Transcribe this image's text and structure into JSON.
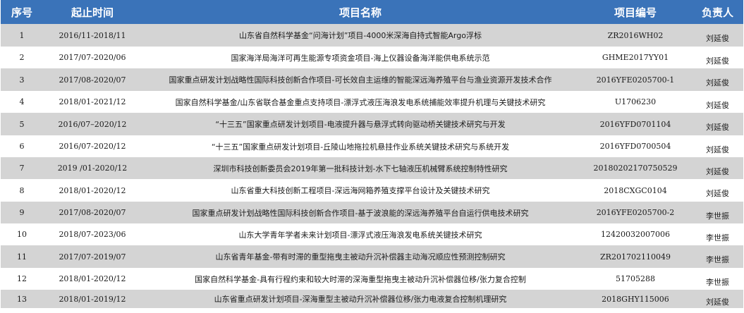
{
  "table": {
    "headers": {
      "index": "序号",
      "period": "起止时间",
      "name": "项目名称",
      "code": "项目编号",
      "owner": "负责人"
    },
    "rows": [
      {
        "index": "1",
        "period": "2016/11-2018/11",
        "name": "山东省自然科学基金“问海计划”项目-4000米深海自持式智能Argo浮标",
        "code": "ZR2016WH02",
        "owner": "刘延俊"
      },
      {
        "index": "2",
        "period": "2017/07-2020/06",
        "name": "国家海洋局海洋可再生能源专项资金项目-海上仪器设备海洋能供电系统示范",
        "code": "GHME2017YY01",
        "owner": "刘延俊"
      },
      {
        "index": "3",
        "period": "2017/08-2020/07",
        "name": "国家重点研发计划战略性国际科技创新合作项目-可长效自主运维的智能深远海养殖平台与渔业资源开发技术合作",
        "code": "2016YFE0205700-1",
        "owner": "刘延俊"
      },
      {
        "index": "4",
        "period": "2018/01-2021/12",
        "name": "国家自然科学基金/山东省联合基金重点支持项目-漂浮式液压海浪发电系统捕能效率提升机理与关键技术研究",
        "code": "U1706230",
        "owner": "刘延俊"
      },
      {
        "index": "5",
        "period": "2016/07–2020/12",
        "name": "“十三五”国家重点研发计划项目-电液提升器与悬浮式转向驱动桥关键技术研究与开发",
        "code": "2016YFD0701104",
        "owner": "刘延俊"
      },
      {
        "index": "6",
        "period": "2016/07-2020/12",
        "name": "“十三五”国家重点研发计划项目-丘陵山地拖拉机悬挂作业系统关键技术研究与系统开发",
        "code": "2016YFD0700504",
        "owner": "刘延俊"
      },
      {
        "index": "7",
        "period": "2019 /01-2020/12",
        "name": "深圳市科技创新委员会2019年第一批科技计划-水下七轴液压机械臂系统控制特性研究",
        "code": "20180202170750529",
        "owner": "刘延俊"
      },
      {
        "index": "8",
        "period": "2018/01-2020/12",
        "name": "山东省重大科技创新工程项目-深远海网箱养殖支撑平台设计及关键技术研究",
        "code": "2018CXGC0104",
        "owner": "刘延俊"
      },
      {
        "index": "9",
        "period": "2017/08-2020/07",
        "name": "国家重点研发计划战略性国际科技创新合作项目-基于波浪能的深远海养殖平台自运行供电技术研究",
        "code": "2016YFE0205700-2",
        "owner": "李世振"
      },
      {
        "index": "10",
        "period": "2018/07-2023/06",
        "name": "山东大学青年学者未来计划项目-漂浮式液压海浪发电系统关键技术研究",
        "code": "12420032007006",
        "owner": "李世振"
      },
      {
        "index": "11",
        "period": "2017/07-2019/07",
        "name": "山东省青年基金-带有时滞的重型拖曳主被动升沉补偿器主动海况顺应性预测控制研究",
        "code": "ZR201702110049",
        "owner": "李世振"
      },
      {
        "index": "12",
        "period": "2018/01-2020/12",
        "name": "国家自然科学基金-具有行程约束和较大时滞的深海重型拖曳主被动升沉补偿器位移/张力复合控制",
        "code": "51705288",
        "owner": "李世振"
      },
      {
        "index": "13",
        "period": "2018/01-2019/12",
        "name": "山东省重点研发计划项目-深海重型主被动升沉补偿器位移/张力电液复合控制机理研究",
        "code": "2018GHY115006",
        "owner": "刘延俊"
      }
    ]
  },
  "colors": {
    "header_bg": "#3a73b9",
    "header_text": "#ffffff",
    "row_odd_bg": "#d4d4d4",
    "row_even_bg": "#ffffff"
  }
}
